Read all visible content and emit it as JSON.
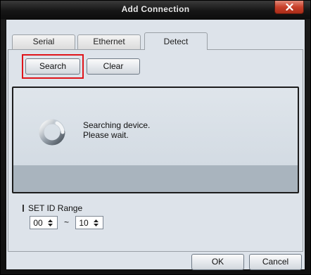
{
  "window": {
    "title": "Add Connection"
  },
  "tabs": [
    {
      "label": "Serial"
    },
    {
      "label": "Ethernet"
    },
    {
      "label": "Detect"
    }
  ],
  "toolbar": {
    "search_label": "Search",
    "clear_label": "Clear"
  },
  "status": {
    "line1": "Searching device.",
    "line2": "Please wait."
  },
  "set_id_range": {
    "label": "SET ID Range",
    "from": "00",
    "separator": "~",
    "to": "10"
  },
  "footer": {
    "ok_label": "OK",
    "cancel_label": "Cancel"
  },
  "colors": {
    "close_button": "#c8402a",
    "highlight_outline": "#e0141a",
    "client_bg": "#dde3ea"
  },
  "icons": {
    "close": "close-icon",
    "spinner": "loading-spinner-icon",
    "up": "arrow-up-icon",
    "down": "arrow-down-icon"
  }
}
